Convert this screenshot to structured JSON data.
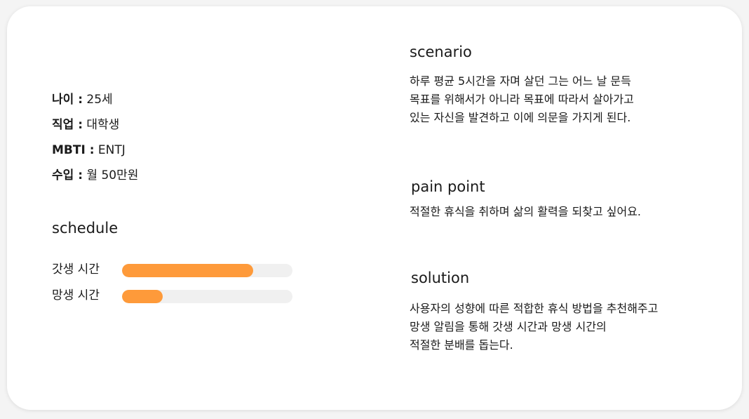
{
  "profile": {
    "age": {
      "label": "나이 :",
      "value": "25세"
    },
    "job": {
      "label": "직업 :",
      "value": "대학생"
    },
    "mbti": {
      "label": "MBTI :",
      "value": "ENTJ"
    },
    "income": {
      "label": "수입 :",
      "value": "월 50만원"
    }
  },
  "schedule": {
    "title": "schedule",
    "items": [
      {
        "label": "갓생 시간",
        "level_percent": 77
      },
      {
        "label": "망생 시간",
        "level_percent": 24
      }
    ],
    "bar_color": "#fe9a3a",
    "track_color": "#f0f0f0"
  },
  "scenario": {
    "title": "scenario",
    "lines": [
      "하루 평균 5시간을 자며 살던 그는 어느 날 문득",
      "목표를 위해서가 아니라 목표에 따라서 살아가고",
      "있는 자신을 발견하고 이에 의문을 가지게 된다."
    ]
  },
  "pain_point": {
    "title": "pain point",
    "lines": [
      "적절한 휴식을 취하며 삶의 활력을 되찾고 싶어요."
    ]
  },
  "solution": {
    "title": "solution",
    "lines": [
      "사용자의 성향에 따른 적합한 휴식 방법을 추천해주고",
      "망생 알림을 통해 갓생 시간과 망생 시간의",
      "적절한 분배를 돕는다."
    ]
  }
}
